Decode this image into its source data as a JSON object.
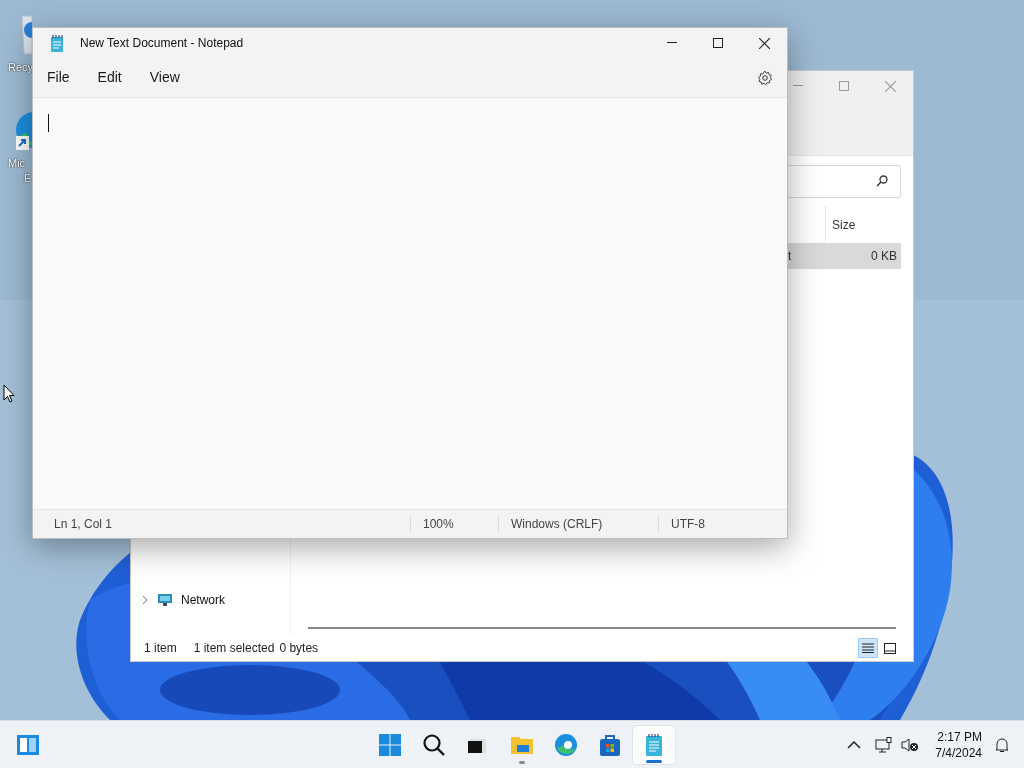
{
  "desktop_icons": [
    {
      "kind": "recycle-bin",
      "label_lines": [
        "Recy"
      ]
    },
    {
      "kind": "browser",
      "label_lines": [
        "Mic",
        "E"
      ]
    }
  ],
  "explorer": {
    "columns": [
      "Size"
    ],
    "rows": [
      {
        "name": "t",
        "size": "0 KB",
        "selected": true
      }
    ],
    "nav_items": [
      {
        "label": "Network",
        "expanded": false
      }
    ],
    "status": {
      "count": "1 item",
      "selection": "1 item selected",
      "size": "0 bytes"
    },
    "views": [
      {
        "kind": "details",
        "selected": true
      },
      {
        "kind": "tiles",
        "selected": false
      }
    ]
  },
  "notepad": {
    "title": "New Text Document - Notepad",
    "menu": [
      "File",
      "Edit",
      "View"
    ],
    "status": [
      "Ln 1, Col 1",
      "100%",
      "Windows (CRLF)",
      "UTF-8"
    ]
  },
  "taskbar": {
    "apps": [
      {
        "kind": "start",
        "running": false,
        "active": false
      },
      {
        "kind": "search",
        "running": false,
        "active": false
      },
      {
        "kind": "task-view",
        "running": false,
        "active": false
      },
      {
        "kind": "file-explorer",
        "running": true,
        "active": false
      },
      {
        "kind": "browser",
        "running": false,
        "active": false
      },
      {
        "kind": "store",
        "running": false,
        "active": false
      },
      {
        "kind": "notepad",
        "running": true,
        "active": true
      }
    ],
    "time": "2:17 PM",
    "date": "7/4/2024"
  }
}
